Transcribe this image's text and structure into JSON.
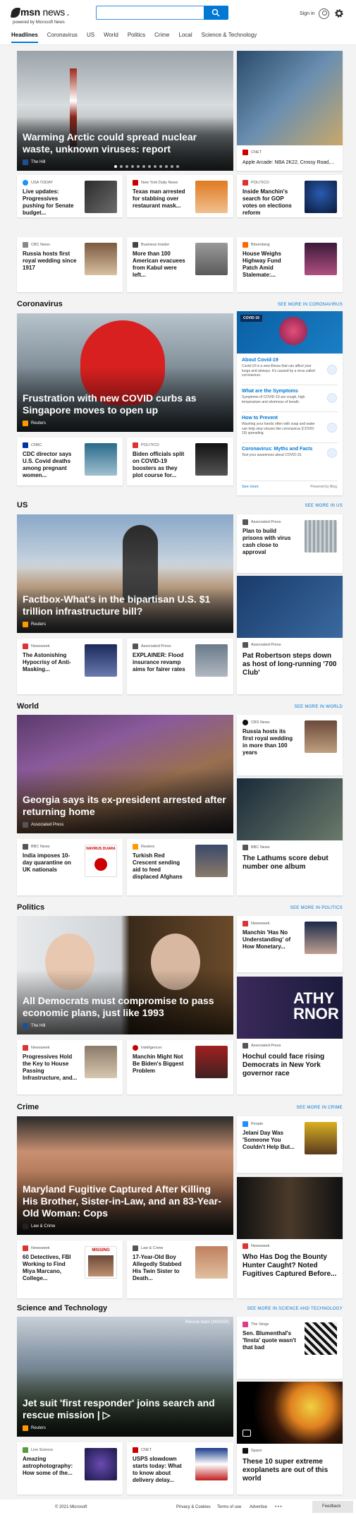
{
  "header": {
    "logo_text": "msn",
    "news_label": "news",
    "powered_by": "powered by Microsoft News",
    "search_placeholder": "",
    "signin": "Sign in",
    "colors": {
      "accent": "#0078d4"
    }
  },
  "nav": [
    "Headlines",
    "Coronavirus",
    "US",
    "World",
    "Politics",
    "Crime",
    "Local",
    "Science & Technology"
  ],
  "headlines": {
    "hero": {
      "title": "Warming Arctic could spread nuclear waste, unknown viruses: report",
      "source": "The Hill"
    },
    "side_top": {
      "source": "CNET",
      "title": "Apple Arcade: NBA 2K22, Crossy Road,..."
    },
    "row1": [
      {
        "source": "USA TODAY",
        "title": "Live updates: Progressives pushing for Senate budget..."
      },
      {
        "source": "New York Daily News",
        "title": "Texas man arrested for stabbing over restaurant mask..."
      },
      {
        "source": "POLITICO",
        "title": "Inside Manchin's search for GOP votes on elections reform"
      }
    ],
    "row2": [
      {
        "source": "CBC News",
        "title": "Russia hosts first royal wedding since 1917"
      },
      {
        "source": "Business Insider",
        "title": "More than 100 American evacuees from Kabul were left..."
      },
      {
        "source": "Bloomberg",
        "title": "House Weighs Highway Fund Patch Amid Stalemate:..."
      }
    ]
  },
  "coronavirus": {
    "section": "Coronavirus",
    "see_more": "SEE MORE IN CORONAVIRUS",
    "hero": {
      "title": "Frustration with new COVID curbs as Singapore moves to open up",
      "source": "Reuters"
    },
    "row": [
      {
        "source": "CNBC",
        "title": "CDC director says U.S. Covid deaths among pregnant women..."
      },
      {
        "source": "POLITICO",
        "title": "Biden officials split on COVID-19 boosters as they plot course for..."
      }
    ],
    "panel": {
      "badge": "COVID 19",
      "items": [
        {
          "h": "About Covid-19",
          "d": "Covid-19 is a new illness that can affect your lungs and airways. It's caused by a virus called coronavirus."
        },
        {
          "h": "What are the Symptoms",
          "d": "Symptoms of COVID-19 are cough, high temperature and shortness of breath."
        },
        {
          "h": "How to Prevent",
          "d": "Washing your hands often with soap and water can help stop viruses like coronavirus (COVID-19) spreading."
        },
        {
          "h": "Coronavirus: Myths and Facts",
          "d": "Test your awareness about COVID-19."
        }
      ],
      "see_more": "See more",
      "powered": "Powered by Bing"
    }
  },
  "us": {
    "section": "US",
    "see_more": "SEE MORE IN US",
    "hero": {
      "title": "Factbox-What's in the bipartisan U.S. $1 trillion infrastructure bill?",
      "source": "Reuters"
    },
    "side1": {
      "source": "Associated Press",
      "title": "Plan to build prisons with virus cash close to approval"
    },
    "side2": {
      "source": "Associated Press",
      "title": "Pat Robertson steps down as host of long-running '700 Club'"
    },
    "row": [
      {
        "source": "Newsweek",
        "title": "The Astonishing Hypocrisy of Anti-Masking..."
      },
      {
        "source": "Associated Press",
        "title": "EXPLAINER: Flood insurance revamp aims for fairer rates"
      }
    ]
  },
  "world": {
    "section": "World",
    "see_more": "SEE MORE IN WORLD",
    "hero": {
      "title": "Georgia says its ex-president arrested after returning home",
      "source": "Associated Press"
    },
    "side1": {
      "source": "CBS News",
      "title": "Russia hosts its first royal wedding in more than 100 years"
    },
    "side2": {
      "source": "BBC News",
      "title": "The Lathums score debut number one album"
    },
    "row": [
      {
        "source": "BBC News",
        "title": "India imposes 10-day quarantine on UK nationals"
      },
      {
        "source": "Reuters",
        "title": "Turkish Red Crescent sending aid to feed displaced Afghans"
      }
    ],
    "thumb_text": "NAVIRUS DUARA"
  },
  "politics": {
    "section": "Politics",
    "see_more": "SEE MORE IN POLITICS",
    "hero": {
      "title": "All Democrats must compromise to pass economic plans, just like 1993",
      "source": "The Hill"
    },
    "side1": {
      "source": "Newsweek",
      "title": "Manchin 'Has No Understanding' of How Monetary..."
    },
    "side2": {
      "source": "Associated Press",
      "title": "Hochul could face rising Democrats in New York governor race"
    },
    "row": [
      {
        "source": "Newsweek",
        "title": "Progressives Hold the Key to House Passing Infrastructure, and..."
      },
      {
        "source": "Intelligencer",
        "title": "Manchin Might Not Be Biden's Biggest Problem"
      }
    ],
    "banner_text": "ATHY RNOR"
  },
  "crime": {
    "section": "Crime",
    "see_more": "SEE MORE IN CRIME",
    "hero": {
      "title": "Maryland Fugitive Captured After Killing His Brother, Sister-in-Law, and an 83-Year-Old Woman: Cops",
      "source": "Law & Crime"
    },
    "side1": {
      "source": "People",
      "title": "Jelani Day Was 'Someone You Couldn't Help But..."
    },
    "side2": {
      "source": "Newsweek",
      "title": "Who Has Dog the Bounty Hunter Caught? Noted Fugitives Captured Before..."
    },
    "row": [
      {
        "source": "Newsweek",
        "title": "60 Detectives, FBI Working to Find Miya Marcano, College..."
      },
      {
        "source": "Law & Crime",
        "title": "17-Year-Old Boy Allegedly Stabbed His Twin Sister to Death..."
      }
    ],
    "thumb_text": "MISSING"
  },
  "science": {
    "section": "Science and Technology",
    "see_more": "SEE MORE IN SCIENCE AND TECHNOLOGY",
    "hero": {
      "title": "Jet suit 'first responder' joins search and rescue mission",
      "source": "Reuters",
      "play": "▷",
      "overlay": "Rescue team (NOSAR)"
    },
    "side1": {
      "source": "The Verge",
      "title": "Sen. Blumenthal's 'finsta' quote wasn't that bad"
    },
    "side2": {
      "source": "Space",
      "title": "These 10 super extreme exoplanets are out of this world"
    },
    "row": [
      {
        "source": "Live Science",
        "title": "Amazing astrophotography: How some of the..."
      },
      {
        "source": "CNET",
        "title": "USPS slowdown starts today: What to know about delivery delay..."
      }
    ]
  },
  "footer": {
    "copyright": "© 2021 Microsoft",
    "links": [
      "Privacy & Cookies",
      "Terms of use",
      "Advertise"
    ],
    "more": "• • •",
    "feedback": "Feedback"
  }
}
